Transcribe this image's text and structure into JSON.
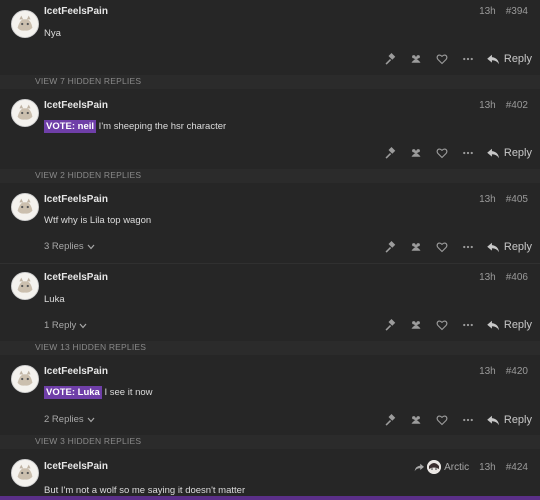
{
  "posts": [
    {
      "username": "IcetFeelsPain",
      "time": "13h",
      "number": "#394",
      "vote": "",
      "text": "Nya",
      "replies_label": "",
      "reply_label": "Reply"
    },
    {
      "username": "IcetFeelsPain",
      "time": "13h",
      "number": "#402",
      "vote": "VOTE: neil",
      "text": " I'm sheeping the hsr character",
      "replies_label": "",
      "reply_label": "Reply"
    },
    {
      "username": "IcetFeelsPain",
      "time": "13h",
      "number": "#405",
      "vote": "",
      "text": "Wtf why is Lila top wagon",
      "replies_label": "3 Replies",
      "reply_label": "Reply"
    },
    {
      "username": "IcetFeelsPain",
      "time": "13h",
      "number": "#406",
      "vote": "",
      "text": "Luka",
      "replies_label": "1 Reply",
      "reply_label": "Reply"
    },
    {
      "username": "IcetFeelsPain",
      "time": "13h",
      "number": "#420",
      "vote": "VOTE: Luka",
      "text": " I see it now",
      "replies_label": "2 Replies",
      "reply_label": "Reply"
    },
    {
      "username": "IcetFeelsPain",
      "time": "13h",
      "number": "#424",
      "vote": "",
      "text": "But I'm not a wolf so me saying it doesn't matter",
      "reply_to": "Arctic",
      "replies_label": "",
      "reply_label": ""
    }
  ],
  "dividers": [
    {
      "label": "VIEW 7 HIDDEN REPLIES"
    },
    {
      "label": "VIEW 2 HIDDEN REPLIES"
    },
    {
      "label": "VIEW 13 HIDDEN REPLIES"
    },
    {
      "label": "VIEW 3 HIDDEN REPLIES"
    }
  ],
  "colors": {
    "vote_highlight": "#6f3fa8",
    "background": "#262626",
    "divider": "#2b2b2b"
  },
  "icons": [
    "hammer-icon",
    "users-icon",
    "heart-icon",
    "more-icon",
    "reply-icon",
    "chevron-down-icon",
    "share-arrow-icon"
  ]
}
